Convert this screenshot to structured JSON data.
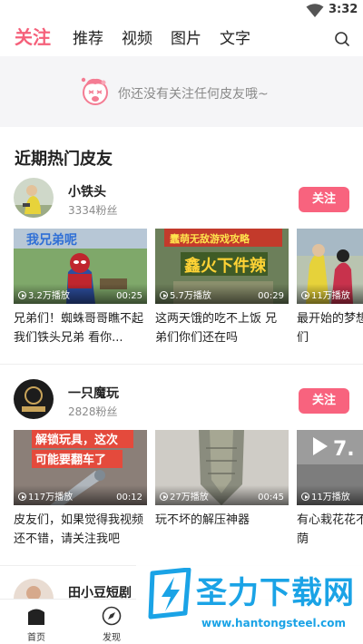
{
  "status_bar": {
    "time": "3:32"
  },
  "top_nav": {
    "tabs": [
      {
        "label": "关注",
        "active": true
      },
      {
        "label": "推荐"
      },
      {
        "label": "视频"
      },
      {
        "label": "图片"
      },
      {
        "label": "文字"
      }
    ],
    "search_icon": "search-icon"
  },
  "empty_state": {
    "message": "你还没有关注任何皮友哦~",
    "icon": "crying-mascot-icon"
  },
  "section": {
    "title": "近期热门皮友"
  },
  "creators": [
    {
      "name": "小铁头",
      "fans": "3334粉丝",
      "follow_label": "关注",
      "videos": [
        {
          "views": "3.2万播放",
          "duration": "00:25",
          "title": "兄弟们！蜘蛛哥哥瞧不起我们铁头兄弟 看你..."
        },
        {
          "views": "5.7万播放",
          "duration": "00:29",
          "title": "这两天饿的吃不上饭 兄弟们你们还在吗"
        },
        {
          "views": "11万播放",
          "duration": "",
          "title": "最开始的梦想实打破，我们"
        }
      ]
    },
    {
      "name": "一只魔玩",
      "fans": "2828粉丝",
      "follow_label": "关注",
      "videos": [
        {
          "views": "117万播放",
          "duration": "00:12",
          "title": "皮友们，如果觉得我视频还不错，请关注我吧"
        },
        {
          "views": "27万播放",
          "duration": "00:45",
          "title": "玩不坏的解压神器"
        },
        {
          "views": "11万播放",
          "duration": "",
          "title": "有心栽花花不开插柳柳成荫"
        }
      ]
    },
    {
      "name": "田小豆短剧"
    }
  ],
  "thumb_texts": {
    "t1": "我兄弟呢",
    "t2a": "蠢萌无敌游戏攻略",
    "t2b": "鑫火下件辣",
    "t4a": "解锁玩具，这次",
    "t4b": "可能要翻车了",
    "t6": "7."
  },
  "bottom_nav": {
    "items": [
      {
        "label": "首页",
        "icon": "home-icon"
      },
      {
        "label": "发现",
        "icon": "compass-icon"
      }
    ]
  },
  "watermark": {
    "title": "圣力下载网",
    "url": "www.hantongsteel.com"
  },
  "colors": {
    "accent": "#f5607a",
    "follow_button": "#f8637e",
    "watermark": "#1aa3e6"
  }
}
